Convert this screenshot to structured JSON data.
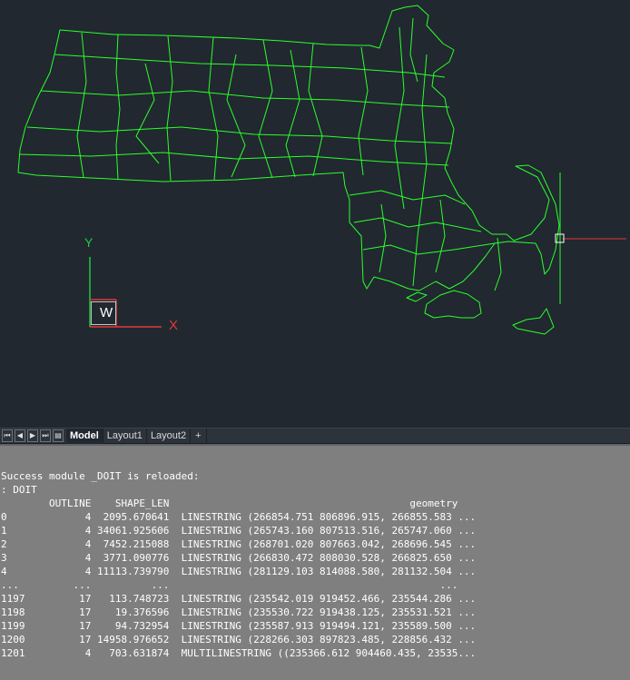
{
  "canvas": {
    "background": "#212830",
    "geometry_color": "#2bff2b",
    "ucs": {
      "w_label": "W",
      "x_label": "X",
      "y_label": "Y",
      "x_color": "#e0383a",
      "y_color": "#23c840"
    }
  },
  "layout_tabs": {
    "nav_icons": [
      "first-icon",
      "prev-icon",
      "next-icon",
      "last-icon",
      "tab-menu-icon"
    ],
    "tabs": [
      {
        "label": "Model",
        "active": true
      },
      {
        "label": "Layout1",
        "active": false
      },
      {
        "label": "Layout2",
        "active": false
      }
    ],
    "add_label": "+"
  },
  "console": {
    "message": "Success module _DOIT is reloaded:",
    "command": ": DOIT",
    "header": {
      "outline": "OUTLINE",
      "shape_len": "SHAPE_LEN",
      "geometry": "geometry"
    },
    "rows": [
      {
        "index": "0",
        "outline": "4",
        "shape_len": "2095.670641",
        "geometry": "LINESTRING (266854.751 806896.915, 266855.583 ..."
      },
      {
        "index": "1",
        "outline": "4",
        "shape_len": "34061.925606",
        "geometry": "LINESTRING (265743.160 807513.516, 265747.060 ..."
      },
      {
        "index": "2",
        "outline": "4",
        "shape_len": "7452.215088",
        "geometry": "LINESTRING (268701.020 807663.042, 268696.545 ..."
      },
      {
        "index": "3",
        "outline": "4",
        "shape_len": "3771.090776",
        "geometry": "LINESTRING (266830.472 808030.528, 266825.650 ..."
      },
      {
        "index": "4",
        "outline": "4",
        "shape_len": "11113.739790",
        "geometry": "LINESTRING (281129.103 814088.580, 281132.504 ..."
      },
      {
        "index": "...",
        "outline": "...",
        "shape_len": "...",
        "geometry": "..."
      },
      {
        "index": "1197",
        "outline": "17",
        "shape_len": "113.748723",
        "geometry": "LINESTRING (235542.019 919452.466, 235544.286 ..."
      },
      {
        "index": "1198",
        "outline": "17",
        "shape_len": "19.376596",
        "geometry": "LINESTRING (235530.722 919438.125, 235531.521 ..."
      },
      {
        "index": "1199",
        "outline": "17",
        "shape_len": "94.732954",
        "geometry": "LINESTRING (235587.913 919494.121, 235589.500 ..."
      },
      {
        "index": "1200",
        "outline": "17",
        "shape_len": "14958.976652",
        "geometry": "LINESTRING (228266.303 897823.485, 228856.432 ..."
      },
      {
        "index": "1201",
        "outline": "4",
        "shape_len": "703.631874",
        "geometry": "MULTILINESTRING ((235366.612 904460.435, 23535..."
      }
    ]
  }
}
